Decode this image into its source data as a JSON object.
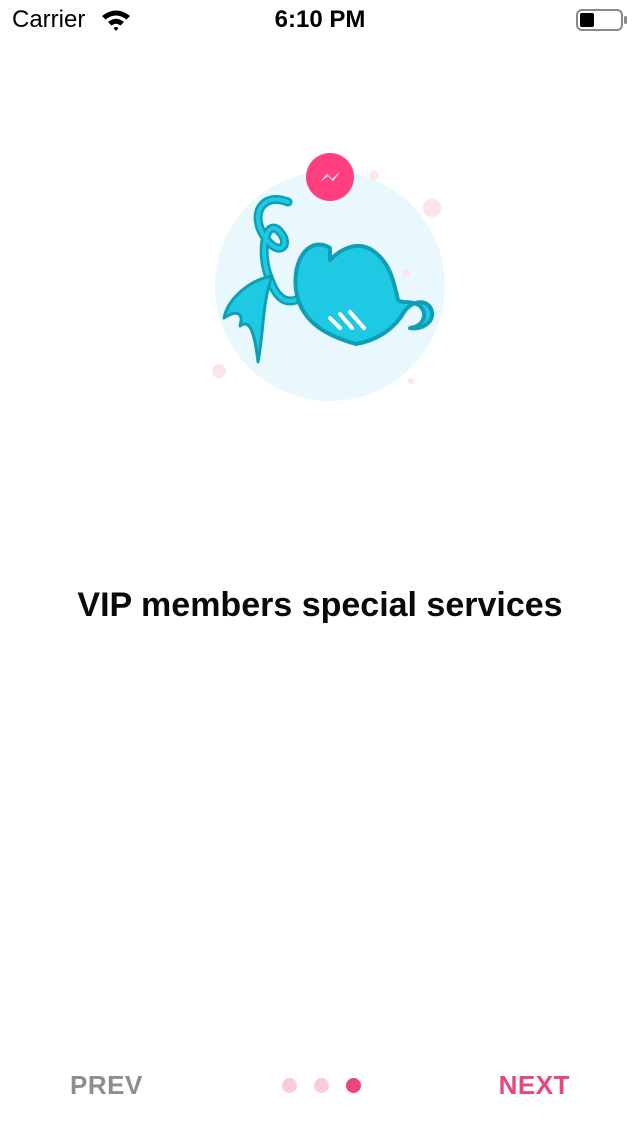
{
  "status_bar": {
    "carrier": "Carrier",
    "time": "6:10 PM",
    "wifi_icon": "wifi-icon",
    "battery_icon": "battery-icon"
  },
  "illustration": {
    "icon": "vip-heart-illustration",
    "badge_icon": "messenger-icon"
  },
  "title": "VIP members special services",
  "footer": {
    "prev_label": "PREV",
    "next_label": "NEXT",
    "page_count": 3,
    "active_page": 3
  },
  "colors": {
    "accent": "#e8467c",
    "dot_inactive": "#f8cdd9",
    "prev_text": "#8e8e8e",
    "heart": "#1ec9e4",
    "heart_outline": "#0e9fb6",
    "circle_bg": "#e8f8fc"
  }
}
